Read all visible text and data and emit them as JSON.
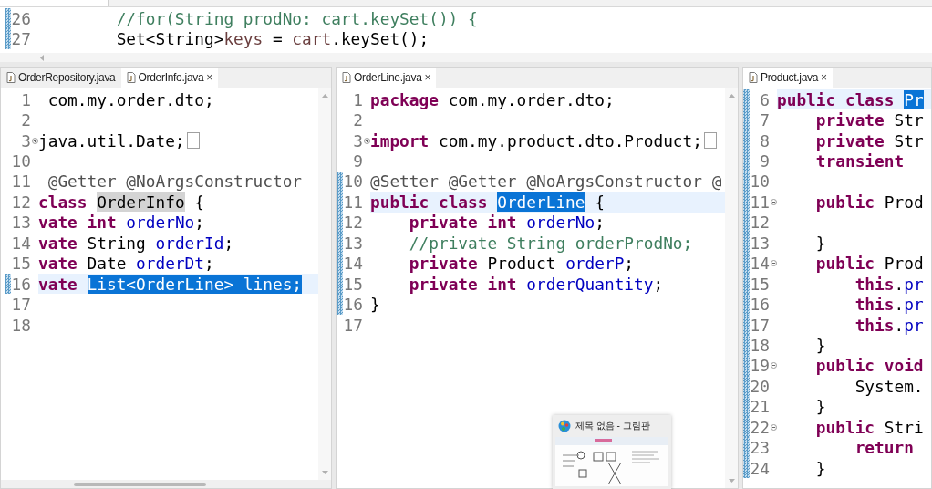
{
  "top_editor": {
    "lines": [
      {
        "number": "26",
        "current": false,
        "changed": true,
        "tokens": [
          {
            "text": "        //for(String prodNo: cart.keySet()) {",
            "kind": "comment"
          }
        ]
      },
      {
        "number": "27",
        "current": false,
        "changed": true,
        "tokens": [
          {
            "text": "        Set<String>",
            "kind": "plain"
          },
          {
            "text": "keys",
            "kind": "variable"
          },
          {
            "text": " = ",
            "kind": "plain"
          },
          {
            "text": "cart",
            "kind": "variable"
          },
          {
            "text": ".keySet();",
            "kind": "plain"
          }
        ]
      }
    ]
  },
  "panes": [
    {
      "tabs": [
        {
          "label": "OrderRepository.java",
          "selected": false
        },
        {
          "label": "OrderInfo.java",
          "selected": true,
          "close": "×"
        }
      ],
      "lines": [
        {
          "number": "1",
          "current": false,
          "changed": false,
          "tokens": [
            {
              "text": " com.my.order.dto;",
              "kind": "plain"
            }
          ]
        },
        {
          "number": "2",
          "current": false,
          "changed": false
        },
        {
          "number": "3",
          "current": false,
          "changed": false,
          "collapsed": true,
          "tokens": [
            {
              "text": "java.util.Date;",
              "kind": "plain"
            }
          ]
        },
        {
          "number": "10",
          "current": false,
          "changed": false
        },
        {
          "number": "11",
          "current": false,
          "changed": false,
          "tokens": [
            {
              "text": " @Getter @NoArgsConstructor",
              "kind": "annotation"
            }
          ]
        },
        {
          "number": "12",
          "current": false,
          "changed": false,
          "tokens": [
            {
              "text": "class ",
              "kind": "keyword"
            },
            {
              "text": "OrderInfo",
              "kind": "occurrence"
            },
            {
              "text": " {",
              "kind": "plain"
            }
          ]
        },
        {
          "number": "13",
          "current": false,
          "changed": false,
          "tokens": [
            {
              "text": "vate int ",
              "kind": "keyword"
            },
            {
              "text": "orderNo",
              "kind": "field"
            },
            {
              "text": ";",
              "kind": "plain"
            }
          ]
        },
        {
          "number": "14",
          "current": false,
          "changed": false,
          "tokens": [
            {
              "text": "vate",
              "kind": "keyword"
            },
            {
              "text": " String ",
              "kind": "plain"
            },
            {
              "text": "orderId",
              "kind": "field"
            },
            {
              "text": ";",
              "kind": "plain"
            }
          ]
        },
        {
          "number": "15",
          "current": false,
          "changed": false,
          "tokens": [
            {
              "text": "vate",
              "kind": "keyword"
            },
            {
              "text": " Date ",
              "kind": "plain"
            },
            {
              "text": "orderDt",
              "kind": "field"
            },
            {
              "text": ";",
              "kind": "plain"
            }
          ]
        },
        {
          "number": "16",
          "current": true,
          "changed": true,
          "tokens": [
            {
              "text": "vate ",
              "kind": "keyword"
            },
            {
              "text": "List<OrderLine> lines;",
              "kind": "selected"
            }
          ]
        },
        {
          "number": "17",
          "current": false,
          "changed": false
        },
        {
          "number": "18",
          "current": false,
          "changed": false
        }
      ]
    },
    {
      "tabs": [
        {
          "label": "OrderLine.java",
          "selected": true,
          "close": "×"
        }
      ],
      "lines": [
        {
          "number": "1",
          "current": false,
          "changed": false,
          "tokens": [
            {
              "text": "package",
              "kind": "keyword"
            },
            {
              "text": " com.my.order.dto;",
              "kind": "plain"
            }
          ]
        },
        {
          "number": "2",
          "current": false,
          "changed": false
        },
        {
          "number": "3",
          "current": false,
          "changed": false,
          "collapsed": true,
          "tokens": [
            {
              "text": "import",
              "kind": "keyword"
            },
            {
              "text": " com.my.product.dto.Product;",
              "kind": "plain"
            }
          ]
        },
        {
          "number": "9",
          "current": false,
          "changed": false
        },
        {
          "number": "10",
          "current": false,
          "changed": true,
          "tokens": [
            {
              "text": "@Setter @Getter @NoArgsConstructor @",
              "kind": "annotation"
            }
          ]
        },
        {
          "number": "11",
          "current": true,
          "changed": true,
          "tokens": [
            {
              "text": "public class ",
              "kind": "keyword"
            },
            {
              "text": "OrderLine",
              "kind": "selected"
            },
            {
              "text": " {",
              "kind": "plain"
            }
          ]
        },
        {
          "number": "12",
          "current": false,
          "changed": true,
          "tokens": [
            {
              "text": "    private int ",
              "kind": "keyword"
            },
            {
              "text": "orderNo",
              "kind": "field"
            },
            {
              "text": ";",
              "kind": "plain"
            }
          ]
        },
        {
          "number": "13",
          "current": false,
          "changed": true,
          "tokens": [
            {
              "text": "    //private String orderProdNo;",
              "kind": "comment"
            }
          ]
        },
        {
          "number": "14",
          "current": false,
          "changed": true,
          "tokens": [
            {
              "text": "    private",
              "kind": "keyword"
            },
            {
              "text": " Product ",
              "kind": "plain"
            },
            {
              "text": "orderP",
              "kind": "field"
            },
            {
              "text": ";",
              "kind": "plain"
            }
          ]
        },
        {
          "number": "15",
          "current": false,
          "changed": true,
          "tokens": [
            {
              "text": "    private int ",
              "kind": "keyword"
            },
            {
              "text": "orderQuantity",
              "kind": "field"
            },
            {
              "text": ";",
              "kind": "plain"
            }
          ]
        },
        {
          "number": "16",
          "current": false,
          "changed": true,
          "tokens": [
            {
              "text": "}",
              "kind": "plain"
            }
          ]
        },
        {
          "number": "17",
          "current": false,
          "changed": false
        }
      ]
    },
    {
      "tabs": [
        {
          "label": "Product.java",
          "selected": true,
          "close": "×"
        }
      ],
      "lines": [
        {
          "number": "6",
          "current": true,
          "changed": true,
          "tokens": [
            {
              "text": "public class ",
              "kind": "keyword"
            },
            {
              "text": "Pr",
              "kind": "selected"
            }
          ]
        },
        {
          "number": "7",
          "current": false,
          "changed": true,
          "tokens": [
            {
              "text": "    private",
              "kind": "keyword"
            },
            {
              "text": " Str",
              "kind": "plain"
            }
          ]
        },
        {
          "number": "8",
          "current": false,
          "changed": true,
          "tokens": [
            {
              "text": "    private",
              "kind": "keyword"
            },
            {
              "text": " Str",
              "kind": "plain"
            }
          ]
        },
        {
          "number": "9",
          "current": false,
          "changed": true,
          "tokens": [
            {
              "text": "    transient",
              "kind": "keyword"
            }
          ]
        },
        {
          "number": "10",
          "current": false,
          "changed": true
        },
        {
          "number": "11",
          "current": false,
          "changed": true,
          "collapsed": false,
          "tokens": [
            {
              "text": "    public",
              "kind": "keyword"
            },
            {
              "text": " Prod",
              "kind": "plain"
            }
          ]
        },
        {
          "number": "12",
          "current": false,
          "changed": true
        },
        {
          "number": "13",
          "current": false,
          "changed": true,
          "tokens": [
            {
              "text": "    }",
              "kind": "plain"
            }
          ]
        },
        {
          "number": "14",
          "current": false,
          "changed": true,
          "collapsed": false,
          "tokens": [
            {
              "text": "    public",
              "kind": "keyword"
            },
            {
              "text": " Prod",
              "kind": "plain"
            }
          ]
        },
        {
          "number": "15",
          "current": false,
          "changed": true,
          "tokens": [
            {
              "text": "        this",
              "kind": "keyword"
            },
            {
              "text": ".",
              "kind": "plain"
            },
            {
              "text": "pr",
              "kind": "field"
            }
          ]
        },
        {
          "number": "16",
          "current": false,
          "changed": true,
          "tokens": [
            {
              "text": "        this",
              "kind": "keyword"
            },
            {
              "text": ".",
              "kind": "plain"
            },
            {
              "text": "pr",
              "kind": "field"
            }
          ]
        },
        {
          "number": "17",
          "current": false,
          "changed": true,
          "tokens": [
            {
              "text": "        this",
              "kind": "keyword"
            },
            {
              "text": ".",
              "kind": "plain"
            },
            {
              "text": "pr",
              "kind": "field"
            }
          ]
        },
        {
          "number": "18",
          "current": false,
          "changed": true,
          "tokens": [
            {
              "text": "    }",
              "kind": "plain"
            }
          ]
        },
        {
          "number": "19",
          "current": false,
          "changed": true,
          "collapsed": false,
          "tokens": [
            {
              "text": "    public void",
              "kind": "keyword"
            }
          ]
        },
        {
          "number": "20",
          "current": false,
          "changed": true,
          "tokens": [
            {
              "text": "        System.",
              "kind": "plain"
            }
          ]
        },
        {
          "number": "21",
          "current": false,
          "changed": true,
          "tokens": [
            {
              "text": "    }",
              "kind": "plain"
            }
          ]
        },
        {
          "number": "22",
          "current": false,
          "changed": true,
          "collapsed": false,
          "tokens": [
            {
              "text": "    public",
              "kind": "keyword"
            },
            {
              "text": " Stri",
              "kind": "plain"
            }
          ]
        },
        {
          "number": "23",
          "current": false,
          "changed": true,
          "tokens": [
            {
              "text": "        return",
              "kind": "keyword"
            }
          ]
        },
        {
          "number": "24",
          "current": false,
          "changed": true,
          "tokens": [
            {
              "text": "    }",
              "kind": "plain"
            }
          ]
        }
      ]
    }
  ],
  "taskbar_preview": {
    "title": "제목 없음 - 그림판"
  }
}
